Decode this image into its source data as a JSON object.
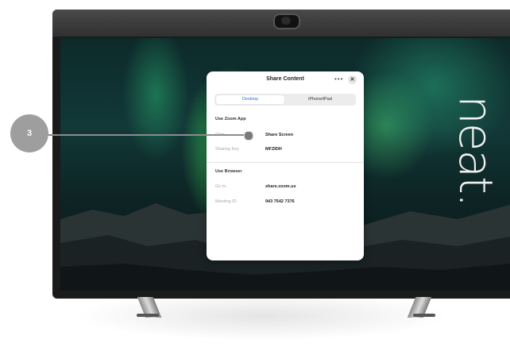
{
  "device": {
    "logo_text": "neat."
  },
  "dialog": {
    "title": "Share Content",
    "more_label": "•••",
    "close_label": "✕",
    "tabs": [
      {
        "label": "Desktop",
        "selected": true
      },
      {
        "label": "iPhone/iPad",
        "selected": false
      }
    ],
    "zoom_app": {
      "heading": "Use Zoom App",
      "rows": [
        {
          "label": "Click",
          "value": "Share Screen"
        },
        {
          "label": "Sharing Key",
          "value": "MFZIDH"
        }
      ]
    },
    "browser": {
      "heading": "Use Browser",
      "rows": [
        {
          "label": "Go to",
          "value": "share.zoom.us"
        },
        {
          "label": "Meeting ID",
          "value": "943 7542 7376"
        }
      ]
    }
  },
  "callout": {
    "number": "3"
  },
  "colors": {
    "accent": "#2d73d6",
    "badge": "#9e9e9e"
  }
}
